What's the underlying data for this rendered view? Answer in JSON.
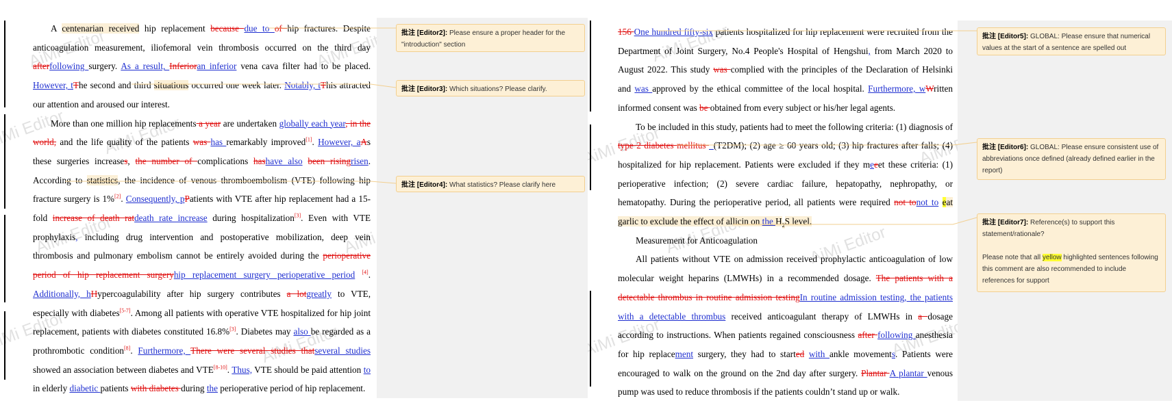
{
  "watermark": "AiMi Editor",
  "left": {
    "p1": {
      "t1": "A ",
      "t2": "centenarian received",
      "t3": " hip replacement ",
      "d1": "because ",
      "i1": "due to ",
      "d2": "of ",
      "t4": "hip fractures. Despite anticoagulation measurement, iliofemoral vein thrombosis occurred on the third day ",
      "d3": "after",
      "i2": "following ",
      "t5": "surgery. ",
      "i3": "As a result, ",
      "d4": "Inferior",
      "i4": "an inferior",
      "t6": " vena cava filter had to be placed. ",
      "i5": "However, t",
      "d5": "T",
      "t7": "he second and third ",
      "t8": "situations",
      "t9": " occurred one week later. ",
      "i6": "Notably, t",
      "d6": "T",
      "t10": "his attracted our attention and aroused our interest."
    },
    "p2": {
      "t1": "More than one million hip replacements",
      "d1": " a year",
      "t2": " are undertaken ",
      "i1": "globally each year",
      "d2": ", in the world,",
      "t3": " and the life quality of the patients ",
      "d3": "was ",
      "i2": "has ",
      "t4": "remarkably improved",
      "r1": "[1]",
      "t5": ". ",
      "i3": "However, a",
      "d4": "A",
      "t6": "s these surgeries increase",
      "d5": "s",
      "t7": ", ",
      "d6": "the number of ",
      "t8": "complications ",
      "d7": "has",
      "i4": "have also",
      "t9": " ",
      "d8": "been rising",
      "i5": "risen",
      "t10": ". According to ",
      "t11": "statistics",
      "t12": ", the incidence of venous thromboembolism (VTE) following hip fracture surgery is 1%",
      "r2": "[2]",
      "t13": ". ",
      "i6": "Consequently, p",
      "d9": "P",
      "t14": "atients with VTE after hip replacement had a 15-fold ",
      "d10": "increase of death rat",
      "i7": "death rate increase",
      "t15": " during hospitalization",
      "r3": "[3]",
      "t16": ". Even with VTE prophylaxis",
      "i8": ",",
      "t17": " including drug intervention and postoperative mobilization, deep vein thrombosis and pulmonary embolism cannot be entirely avoided during the ",
      "d11": "perioperative period of hip replacement surgery",
      "i9": "hip replacement surgery perioperative period",
      "t18": " ",
      "r4": "[4]",
      "t19": ". ",
      "i10": "Additionally, h",
      "d12": "H",
      "t20": "ypercoagulability after hip surgery contributes ",
      "d13": "a lot",
      "i11": "greatly",
      "t21": " to VTE, especially with diabetes",
      "r5": "[5-7]",
      "t22": ". Among all patients with operative VTE hospitalized for hip joint replacement, patients with diabetes constituted 16.8%",
      "r6": "[3]",
      "t23": ". Diabetes may ",
      "i12": "also ",
      "t24": "be regarded as a prothrombotic condition",
      "r7": "[8]",
      "t25": ". ",
      "i13": "Furthermore, ",
      "d14": "There were several studies that",
      "i14": "several studies",
      "t26": " showed an association between diabetes and VTE",
      "r8": "[8-10]",
      "t27": ". ",
      "i15": "Thus,",
      "t28": " VTE should be paid attention ",
      "i16": "to ",
      "t29": "in elderly ",
      "i17": "diabetic ",
      "t30": "patients ",
      "d15": "with diabetes ",
      "t31": "during ",
      "i18": "the",
      "t32": " perioperative period of hip replacement."
    },
    "comments": [
      {
        "author": "批注 [Editor2]:",
        "text": "Please ensure a proper header for the \"introduction\" section"
      },
      {
        "author": "批注 [Editor3]:",
        "text": "Which situations? Please clarify."
      },
      {
        "author": "批注 [Editor4]:",
        "text": "What statistics? Please clarify here"
      }
    ]
  },
  "right": {
    "p1": {
      "d1": "156 ",
      "i1": "One hundred fifty-six",
      "t1": " patients hospitalized for hip replacement were recruited from the Department of Joint Surgery, No.4 People's Hospital of Hengshui",
      "i2": ",",
      "t2": " from March 2020 to August 2022. This study ",
      "d2": "was ",
      "t3": "complied with the principles of the Declaration of Helsinki and ",
      "i3": "was ",
      "t4": "approved by the ethical committee of the local hospital. ",
      "i4": "Furthermore, w",
      "d3": "W",
      "t5": "ritten informed consent was ",
      "d4": "be ",
      "t6": "obtained from every subject or his/her legal agents."
    },
    "p2": {
      "t1": "To be included in this study, patients had to meet the following criteria: (1) diagnosis of ",
      "d1": "type 2 diabetes mellitus ",
      "i1": "_",
      "t2": "(T2DM); (2) age ≥ 60 years old; (3) hip fractures after falls; (4) hospitalized for hip replacement. Patients were excluded if they m",
      "i2": "e",
      "d2": "e",
      "t3": "et these criteria: (1) perioperative infection; (2) severe cardiac failure, hepatopathy, nephropathy, or hematopathy. During the perioperative period, all patients were required ",
      "d3": "not to",
      "i3": "not to",
      "t4": " ",
      "y1": "e",
      "t5": "at garlic to exclude the effect of allicin on ",
      "i4": "the ",
      "t6": "H",
      "t7": "2",
      "t8": "S level."
    },
    "p3": "Measurement for Anticoagulation",
    "p4": {
      "t1": "All patients without VTE on admission received prophylactic anticoagulation of low molecular weight heparins (LMWHs) in a recommended dosage. ",
      "d1": "The patients with a detectable thrombus in routine admission testing",
      "i1": "In routine admission testing, the patients with a detectable thrombus",
      "t2": " received anticoagulant therapy of LMWHs in ",
      "d2": "a ",
      "t3": "dosage according to instructions. When patients regained consciousness ",
      "d3": "after ",
      "i2": "following ",
      "t4": "anesthesia for hip replace",
      "i3": "ment",
      "t5": " surgery, they had to start",
      "d4": "ed",
      "t6": " ",
      "i4": "with ",
      "t7": "ankle movement",
      "i5": "s",
      "t8": ". Patients were encouraged to walk on the ground on the 2nd day after surgery. ",
      "d5": "Plantar ",
      "i6": "A plantar ",
      "t9": "venous pump was used to reduce thrombosis if the patients couldn’t stand up or walk."
    },
    "comments": [
      {
        "author": "批注 [Editor5]:",
        "text": "GLOBAL: Please ensure that numerical values at the start of a sentence are spelled out"
      },
      {
        "author": "批注 [Editor6]:",
        "text": "GLOBAL: Please ensure consistent use of abbreviations once defined (already defined earlier in the report)"
      },
      {
        "author": "批注 [Editor7]:",
        "text": "Reference(s) to support this statement/rationale?",
        "note1": "Please note that all ",
        "note_hl": "yellow",
        "note2": " highlighted sentences following this comment are also recommended to include references for support"
      }
    ]
  }
}
